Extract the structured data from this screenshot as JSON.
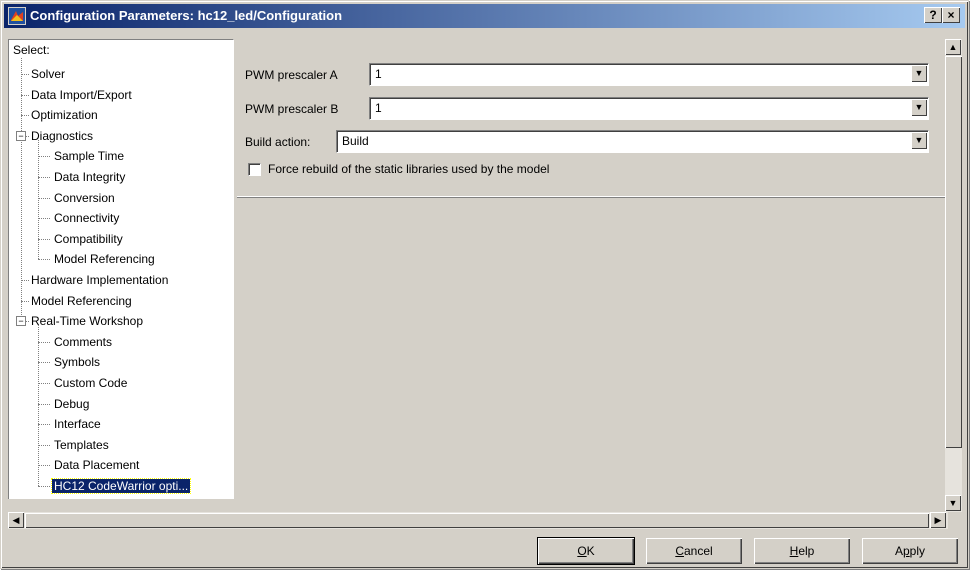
{
  "window": {
    "title": "Configuration Parameters: hc12_led/Configuration",
    "help_button": "?",
    "close_button": "×"
  },
  "tree": {
    "header": "Select:",
    "items": [
      {
        "label": "Solver",
        "level": 1
      },
      {
        "label": "Data Import/Export",
        "level": 1
      },
      {
        "label": "Optimization",
        "level": 1
      },
      {
        "label": "Diagnostics",
        "level": 1,
        "expanded": true
      },
      {
        "label": "Sample Time",
        "level": 2
      },
      {
        "label": "Data Integrity",
        "level": 2
      },
      {
        "label": "Conversion",
        "level": 2
      },
      {
        "label": "Connectivity",
        "level": 2
      },
      {
        "label": "Compatibility",
        "level": 2
      },
      {
        "label": "Model Referencing",
        "level": 2
      },
      {
        "label": "Hardware Implementation",
        "level": 1
      },
      {
        "label": "Model Referencing",
        "level": 1
      },
      {
        "label": "Real-Time Workshop",
        "level": 1,
        "expanded": true
      },
      {
        "label": "Comments",
        "level": 2
      },
      {
        "label": "Symbols",
        "level": 2
      },
      {
        "label": "Custom Code",
        "level": 2
      },
      {
        "label": "Debug",
        "level": 2
      },
      {
        "label": "Interface",
        "level": 2
      },
      {
        "label": "Templates",
        "level": 2
      },
      {
        "label": "Data Placement",
        "level": 2
      },
      {
        "label": "HC12 CodeWarrior opti...",
        "level": 2,
        "selected": true
      }
    ],
    "selected_color": "#0a246a"
  },
  "options": {
    "pwm_a_label": "PWM prescaler A",
    "pwm_a_value": "1",
    "pwm_b_label": "PWM prescaler B",
    "pwm_b_value": "1",
    "build_action_label": "Build action:",
    "build_action_value": "Build",
    "force_rebuild_label": "Force rebuild of the static libraries used by the model",
    "force_rebuild_checked": false
  },
  "buttons": {
    "ok_mnemonic": "O",
    "ok_rest": "K",
    "cancel_mnemonic": "C",
    "cancel_rest": "ancel",
    "help_mnemonic": "H",
    "help_rest": "elp",
    "apply_prefix": "A",
    "apply_mnemonic": "p",
    "apply_rest": "ply"
  },
  "icons": {
    "app": "simulink-icon",
    "scroll_up": "arrow-up-icon",
    "scroll_down": "arrow-down-icon",
    "scroll_left": "arrow-left-icon",
    "scroll_right": "arrow-right-icon",
    "dropdown": "chevron-down-icon"
  }
}
